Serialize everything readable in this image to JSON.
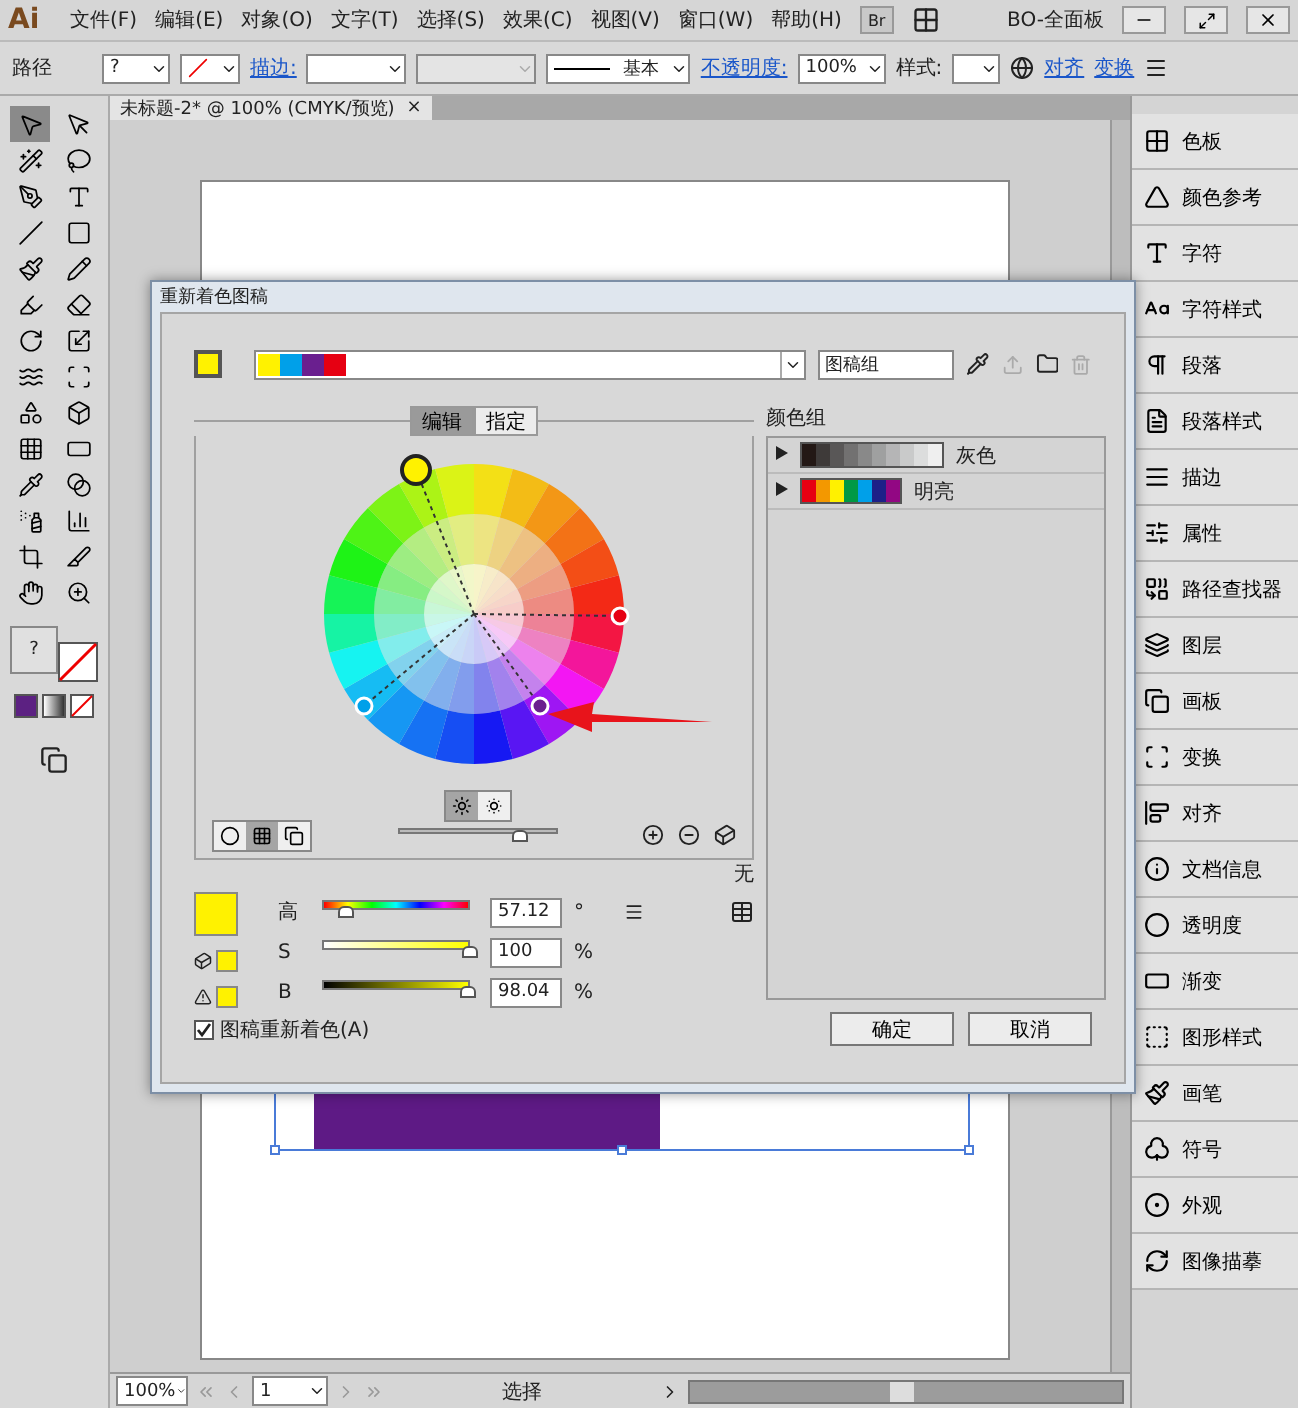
{
  "menu_bar": {
    "logo": "Ai",
    "items": [
      "文件(F)",
      "编辑(E)",
      "对象(O)",
      "文字(T)",
      "选择(S)",
      "效果(C)",
      "视图(V)",
      "窗口(W)",
      "帮助(H)"
    ],
    "bridge": "Br",
    "workspace": "BO-全面板"
  },
  "control_bar": {
    "selection": "路径",
    "fill": "?",
    "stroke_label": "描边:",
    "stroke_profile": "基本",
    "opacity_label": "不透明度:",
    "opacity": "100%",
    "style_label": "样式:",
    "align": "对齐",
    "transform": "变换"
  },
  "tools": [
    {
      "selected": true
    },
    {
      "selected": false
    },
    {
      "selected": false
    },
    {
      "selected": false
    },
    {
      "selected": false
    },
    {
      "selected": false
    },
    {
      "selected": false
    },
    {
      "selected": false
    },
    {
      "selected": false
    },
    {
      "selected": false
    },
    {
      "selected": false
    },
    {
      "selected": false
    },
    {
      "selected": false
    },
    {
      "selected": false
    },
    {
      "selected": false
    },
    {
      "selected": false
    },
    {
      "selected": false
    },
    {
      "selected": false
    },
    {
      "selected": false
    },
    {
      "selected": false
    },
    {
      "selected": false
    },
    {
      "selected": false
    },
    {
      "selected": false
    },
    {
      "selected": false
    },
    {
      "selected": false
    },
    {
      "selected": false
    },
    {
      "selected": false
    },
    {
      "selected": false
    }
  ],
  "fill_stroke": {
    "fill": "?"
  },
  "document_tab": {
    "title": "未标题-2* @ 100% (CMYK/预览)",
    "close": "×"
  },
  "panels": [
    {
      "label": "色板"
    },
    {
      "label": "颜色参考"
    },
    {
      "label": "字符"
    },
    {
      "label": "字符样式"
    },
    {
      "label": "段落"
    },
    {
      "label": "段落样式"
    },
    {
      "label": "描边"
    },
    {
      "label": "属性"
    },
    {
      "label": "路径查找器"
    },
    {
      "label": "图层"
    },
    {
      "label": "画板"
    },
    {
      "label": "变换"
    },
    {
      "label": "对齐"
    },
    {
      "label": "文档信息"
    },
    {
      "label": "透明度"
    },
    {
      "label": "渐变"
    },
    {
      "label": "图形样式"
    },
    {
      "label": "画笔"
    },
    {
      "label": "符号"
    },
    {
      "label": "外观"
    },
    {
      "label": "图像描摹"
    }
  ],
  "dialog": {
    "title": "重新着色图稿",
    "current_colors": [
      {
        "color": "#fff200"
      },
      {
        "color": "#00a0e9"
      },
      {
        "color": "#6a1f8f"
      },
      {
        "color": "#e60012"
      }
    ],
    "group_name": "图稿组",
    "tabs": [
      {
        "label": "编辑",
        "selected": true
      },
      {
        "label": "指定",
        "selected": false
      }
    ],
    "brightness": {
      "level": 0.77
    },
    "harmony_note": "无",
    "sliders": [
      {
        "kind": "hue",
        "label": "高",
        "value": "57.12",
        "unit": "°",
        "level": 0.16
      },
      {
        "kind": "saturation",
        "label": "S",
        "value": "100",
        "unit": "%",
        "level": 1
      },
      {
        "kind": "brightness",
        "label": "B",
        "value": "98.04",
        "unit": "%",
        "level": 0.98
      }
    ],
    "color_groups_label": "颜色组",
    "color_groups": [
      {
        "name": "灰色",
        "expanded": false,
        "swatches": [
          {
            "color": "#231815"
          },
          {
            "color": "#3e3a39"
          },
          {
            "color": "#595757"
          },
          {
            "color": "#727171"
          },
          {
            "color": "#898989"
          },
          {
            "color": "#9fa0a0"
          },
          {
            "color": "#b5b5b6"
          },
          {
            "color": "#c9caca"
          },
          {
            "color": "#dcdddd"
          },
          {
            "color": "#efefef"
          }
        ]
      },
      {
        "name": "明亮",
        "expanded": false,
        "swatches": [
          {
            "color": "#e60012"
          },
          {
            "color": "#f39800"
          },
          {
            "color": "#fff100"
          },
          {
            "color": "#009944"
          },
          {
            "color": "#00a0e9"
          },
          {
            "color": "#1d2088"
          },
          {
            "color": "#920783"
          }
        ]
      }
    ],
    "recolor": {
      "label": "图稿重新着色(A)",
      "checked": true
    },
    "buttons": [
      "确定",
      "取消"
    ]
  },
  "status_bar": {
    "zoom": "100%",
    "page": "1",
    "tool": "选择"
  }
}
